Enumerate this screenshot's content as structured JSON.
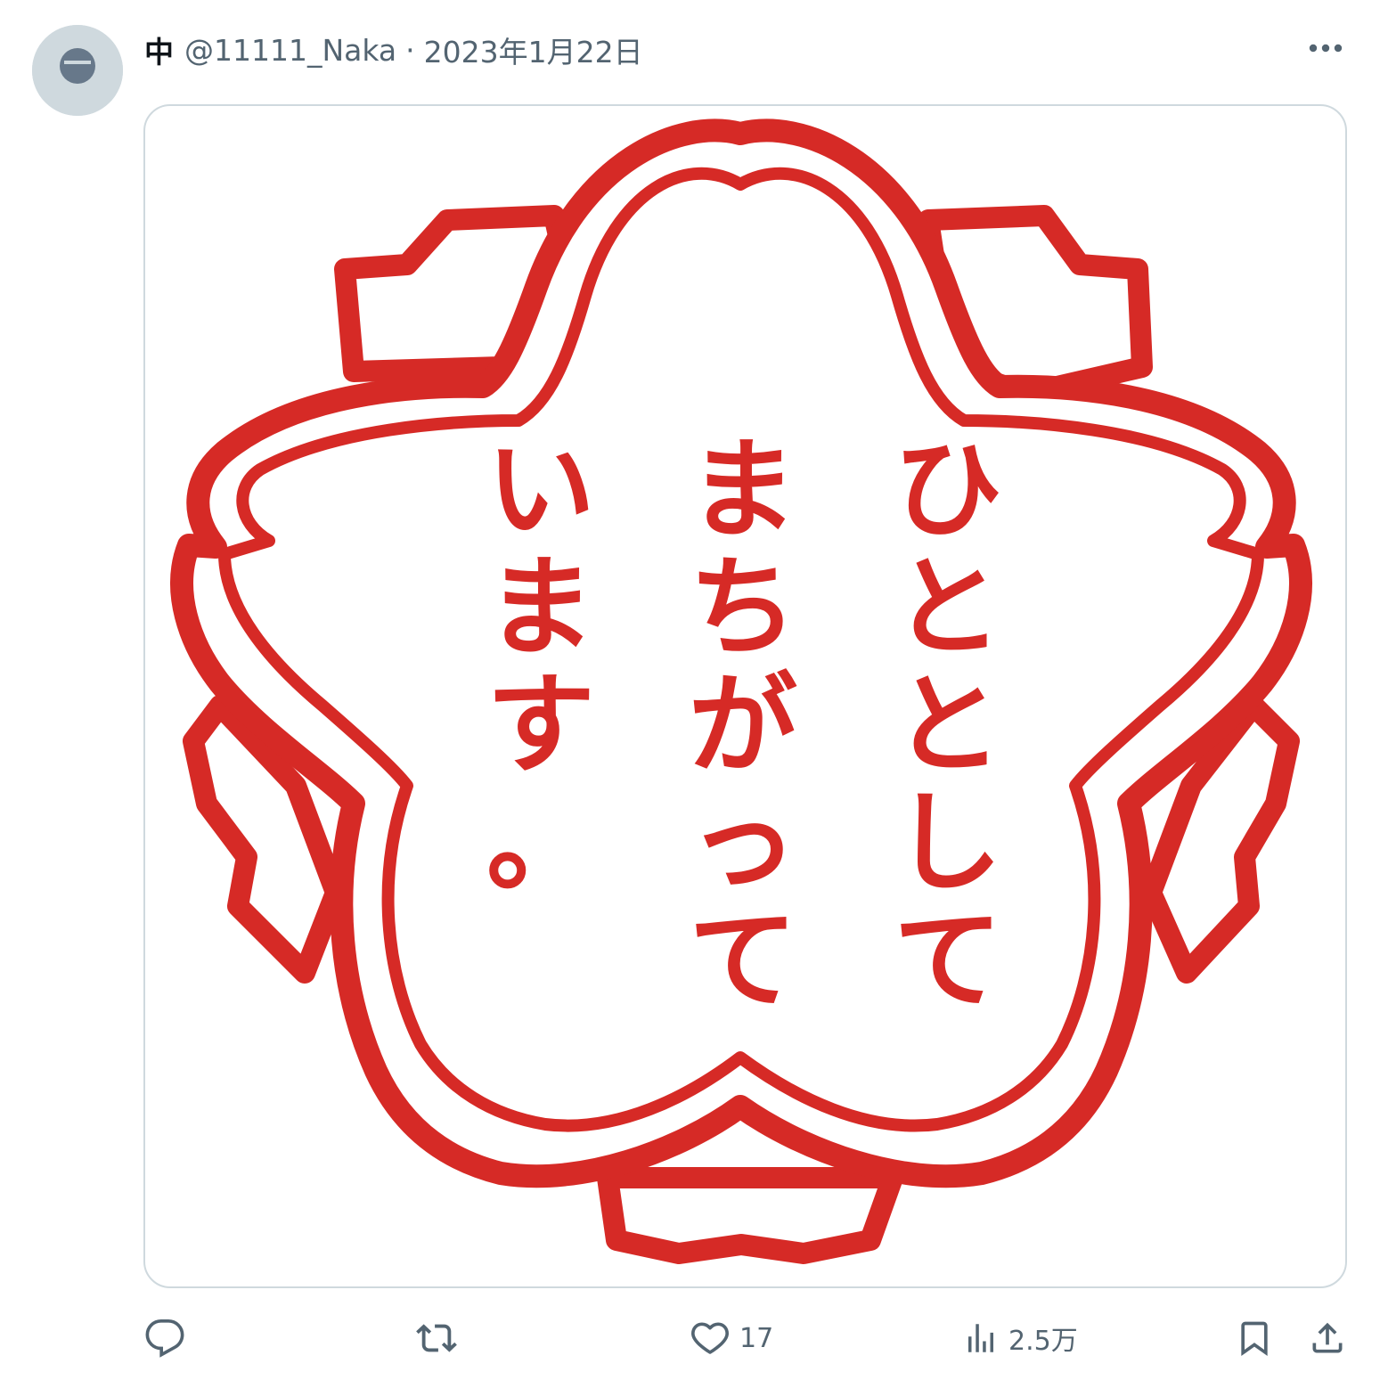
{
  "tweet": {
    "display_name": "中",
    "handle": "@11111_Naka",
    "separator": "·",
    "date": "2023年1月22日",
    "more_icon": "more-horizontal-icon"
  },
  "media": {
    "emblem_icon": "sakura-emblem",
    "emblem_color": "#d62a26",
    "stamp_lines": [
      "ひととして",
      "まちがって",
      "います。"
    ]
  },
  "actions": {
    "reply": {
      "icon": "reply-icon"
    },
    "retweet": {
      "icon": "retweet-icon"
    },
    "like": {
      "icon": "heart-icon",
      "count": "17"
    },
    "views": {
      "icon": "views-icon",
      "count": "2.5万"
    },
    "bookmark": {
      "icon": "bookmark-icon"
    },
    "share": {
      "icon": "share-icon"
    }
  },
  "colors": {
    "text_primary": "#0f1419",
    "text_secondary": "#536471",
    "border": "#cfd9de"
  }
}
